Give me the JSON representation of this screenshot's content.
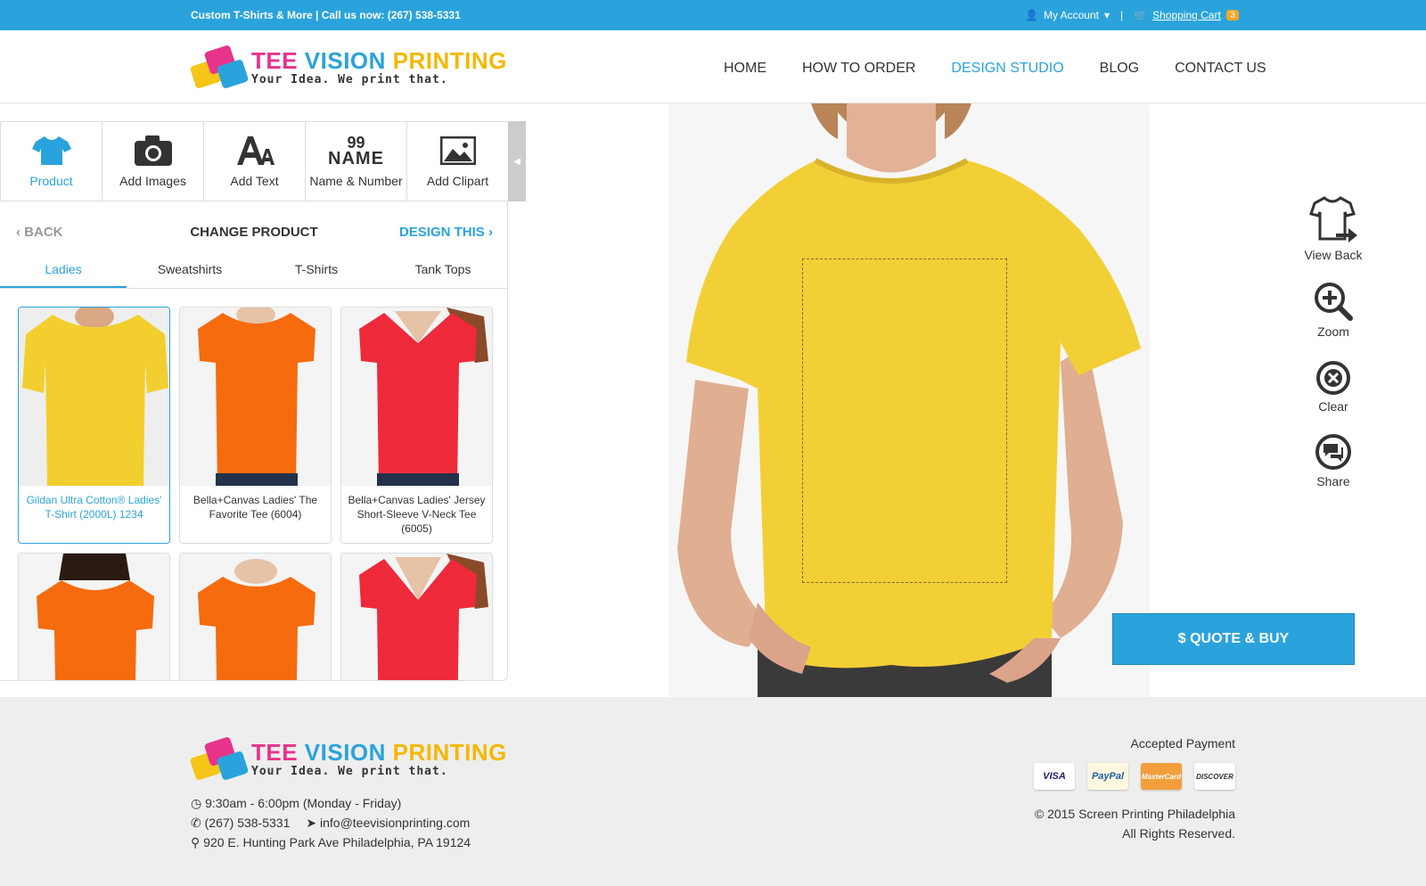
{
  "topbar": {
    "tagline": "Custom T-Shirts & More | Call us now: (267) 538-5331",
    "account_label": "My Account",
    "separator": "|",
    "cart_label": "Shopping Cart",
    "cart_count": "3"
  },
  "brand": {
    "name": "TEE VISION PRINTING",
    "tagline": "Your Idea. We print that."
  },
  "nav": {
    "items": [
      {
        "label": "HOME",
        "active": false
      },
      {
        "label": "HOW TO ORDER",
        "active": false
      },
      {
        "label": "DESIGN STUDIO",
        "active": true
      },
      {
        "label": "BLOG",
        "active": false
      },
      {
        "label": "CONTACT US",
        "active": false
      }
    ]
  },
  "toolbar": {
    "items": [
      {
        "label": "Product",
        "icon": "tshirt-icon",
        "active": true
      },
      {
        "label": "Add Images",
        "icon": "camera-icon",
        "active": false
      },
      {
        "label": "Add Text",
        "icon": "text-icon",
        "active": false
      },
      {
        "label": "Name & Number",
        "icon": "name-number-icon",
        "active": false,
        "icon_text_top": "99",
        "icon_text_bottom": "NAME"
      },
      {
        "label": "Add Clipart",
        "icon": "image-icon",
        "active": false
      }
    ]
  },
  "panel": {
    "back_label": "BACK",
    "title": "CHANGE PRODUCT",
    "design_label": "DESIGN THIS",
    "tabs": [
      "Ladies",
      "Sweatshirts",
      "T-Shirts",
      "Tank Tops"
    ],
    "active_tab": "Ladies",
    "products": [
      {
        "name": "Gildan Ultra Cotton® Ladies' T-Shirt (2000L) 1234",
        "color": "#f2cf2e",
        "selected": true
      },
      {
        "name": "Bella+Canvas Ladies' The Favorite Tee (6004)",
        "color": "#f66b0e",
        "selected": false
      },
      {
        "name": "Bella+Canvas Ladies' Jersey Short-Sleeve V-Neck Tee (6005)",
        "color": "#ee2a3a",
        "selected": false
      },
      {
        "name": "",
        "color": "#f66b0e",
        "selected": false
      },
      {
        "name": "",
        "color": "#f66b0e",
        "selected": false
      },
      {
        "name": "",
        "color": "#ee2a3a",
        "selected": false
      }
    ]
  },
  "stage": {
    "shirt_color": "#f3cf36"
  },
  "side_tools": [
    {
      "label": "View Back",
      "icon": "view-back-icon"
    },
    {
      "label": "Zoom",
      "icon": "zoom-in-icon"
    },
    {
      "label": "Clear",
      "icon": "clear-icon"
    },
    {
      "label": "Share",
      "icon": "share-icon"
    }
  ],
  "quote_button": "$ QUOTE & BUY",
  "footer": {
    "hours": "9:30am - 6:00pm (Monday - Friday)",
    "phone": "(267) 538-5331",
    "email": "info@teevisionprinting.com",
    "address": "920 E. Hunting Park Ave Philadelphia, PA 19124",
    "payment_title": "Accepted Payment",
    "payments": [
      "VISA",
      "PayPal",
      "MasterCard",
      "DISCOVER"
    ],
    "copyright": "© 2015 Screen Printing Philadelphia",
    "rights": "All Rights Reserved."
  },
  "colors": {
    "accent": "#2aa3dc",
    "badge": "#f5a623",
    "footer_bg": "#eeeeee"
  }
}
